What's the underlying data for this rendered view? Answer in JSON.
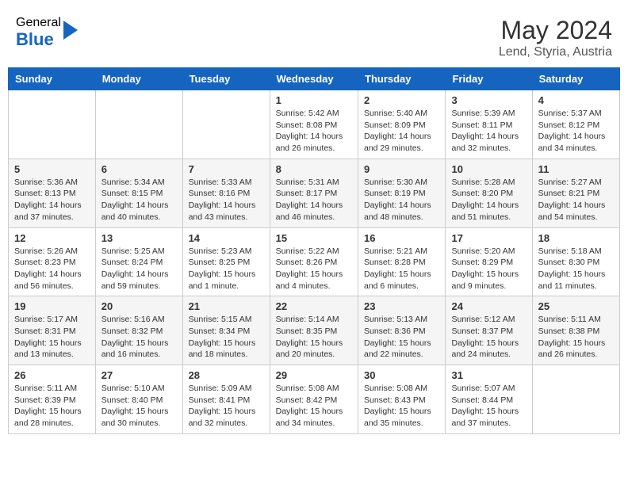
{
  "header": {
    "logo_general": "General",
    "logo_blue": "Blue",
    "month_year": "May 2024",
    "location": "Lend, Styria, Austria"
  },
  "weekdays": [
    "Sunday",
    "Monday",
    "Tuesday",
    "Wednesday",
    "Thursday",
    "Friday",
    "Saturday"
  ],
  "weeks": [
    [
      {
        "day": "",
        "info": ""
      },
      {
        "day": "",
        "info": ""
      },
      {
        "day": "",
        "info": ""
      },
      {
        "day": "1",
        "info": "Sunrise: 5:42 AM\nSunset: 8:08 PM\nDaylight: 14 hours\nand 26 minutes."
      },
      {
        "day": "2",
        "info": "Sunrise: 5:40 AM\nSunset: 8:09 PM\nDaylight: 14 hours\nand 29 minutes."
      },
      {
        "day": "3",
        "info": "Sunrise: 5:39 AM\nSunset: 8:11 PM\nDaylight: 14 hours\nand 32 minutes."
      },
      {
        "day": "4",
        "info": "Sunrise: 5:37 AM\nSunset: 8:12 PM\nDaylight: 14 hours\nand 34 minutes."
      }
    ],
    [
      {
        "day": "5",
        "info": "Sunrise: 5:36 AM\nSunset: 8:13 PM\nDaylight: 14 hours\nand 37 minutes."
      },
      {
        "day": "6",
        "info": "Sunrise: 5:34 AM\nSunset: 8:15 PM\nDaylight: 14 hours\nand 40 minutes."
      },
      {
        "day": "7",
        "info": "Sunrise: 5:33 AM\nSunset: 8:16 PM\nDaylight: 14 hours\nand 43 minutes."
      },
      {
        "day": "8",
        "info": "Sunrise: 5:31 AM\nSunset: 8:17 PM\nDaylight: 14 hours\nand 46 minutes."
      },
      {
        "day": "9",
        "info": "Sunrise: 5:30 AM\nSunset: 8:19 PM\nDaylight: 14 hours\nand 48 minutes."
      },
      {
        "day": "10",
        "info": "Sunrise: 5:28 AM\nSunset: 8:20 PM\nDaylight: 14 hours\nand 51 minutes."
      },
      {
        "day": "11",
        "info": "Sunrise: 5:27 AM\nSunset: 8:21 PM\nDaylight: 14 hours\nand 54 minutes."
      }
    ],
    [
      {
        "day": "12",
        "info": "Sunrise: 5:26 AM\nSunset: 8:23 PM\nDaylight: 14 hours\nand 56 minutes."
      },
      {
        "day": "13",
        "info": "Sunrise: 5:25 AM\nSunset: 8:24 PM\nDaylight: 14 hours\nand 59 minutes."
      },
      {
        "day": "14",
        "info": "Sunrise: 5:23 AM\nSunset: 8:25 PM\nDaylight: 15 hours\nand 1 minute."
      },
      {
        "day": "15",
        "info": "Sunrise: 5:22 AM\nSunset: 8:26 PM\nDaylight: 15 hours\nand 4 minutes."
      },
      {
        "day": "16",
        "info": "Sunrise: 5:21 AM\nSunset: 8:28 PM\nDaylight: 15 hours\nand 6 minutes."
      },
      {
        "day": "17",
        "info": "Sunrise: 5:20 AM\nSunset: 8:29 PM\nDaylight: 15 hours\nand 9 minutes."
      },
      {
        "day": "18",
        "info": "Sunrise: 5:18 AM\nSunset: 8:30 PM\nDaylight: 15 hours\nand 11 minutes."
      }
    ],
    [
      {
        "day": "19",
        "info": "Sunrise: 5:17 AM\nSunset: 8:31 PM\nDaylight: 15 hours\nand 13 minutes."
      },
      {
        "day": "20",
        "info": "Sunrise: 5:16 AM\nSunset: 8:32 PM\nDaylight: 15 hours\nand 16 minutes."
      },
      {
        "day": "21",
        "info": "Sunrise: 5:15 AM\nSunset: 8:34 PM\nDaylight: 15 hours\nand 18 minutes."
      },
      {
        "day": "22",
        "info": "Sunrise: 5:14 AM\nSunset: 8:35 PM\nDaylight: 15 hours\nand 20 minutes."
      },
      {
        "day": "23",
        "info": "Sunrise: 5:13 AM\nSunset: 8:36 PM\nDaylight: 15 hours\nand 22 minutes."
      },
      {
        "day": "24",
        "info": "Sunrise: 5:12 AM\nSunset: 8:37 PM\nDaylight: 15 hours\nand 24 minutes."
      },
      {
        "day": "25",
        "info": "Sunrise: 5:11 AM\nSunset: 8:38 PM\nDaylight: 15 hours\nand 26 minutes."
      }
    ],
    [
      {
        "day": "26",
        "info": "Sunrise: 5:11 AM\nSunset: 8:39 PM\nDaylight: 15 hours\nand 28 minutes."
      },
      {
        "day": "27",
        "info": "Sunrise: 5:10 AM\nSunset: 8:40 PM\nDaylight: 15 hours\nand 30 minutes."
      },
      {
        "day": "28",
        "info": "Sunrise: 5:09 AM\nSunset: 8:41 PM\nDaylight: 15 hours\nand 32 minutes."
      },
      {
        "day": "29",
        "info": "Sunrise: 5:08 AM\nSunset: 8:42 PM\nDaylight: 15 hours\nand 34 minutes."
      },
      {
        "day": "30",
        "info": "Sunrise: 5:08 AM\nSunset: 8:43 PM\nDaylight: 15 hours\nand 35 minutes."
      },
      {
        "day": "31",
        "info": "Sunrise: 5:07 AM\nSunset: 8:44 PM\nDaylight: 15 hours\nand 37 minutes."
      },
      {
        "day": "",
        "info": ""
      }
    ]
  ]
}
